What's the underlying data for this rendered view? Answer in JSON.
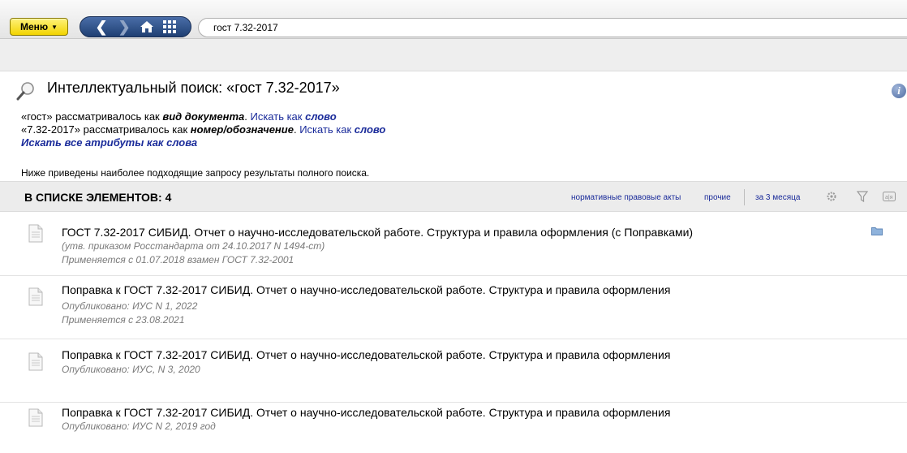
{
  "toolbar": {
    "menu_label": "Меню",
    "search_value": "гост 7.32-2017",
    "icons": [
      "back-icon",
      "forward-icon",
      "home-icon",
      "grid-icon"
    ]
  },
  "header": {
    "title": "Интеллектуальный поиск: «гост 7.32-2017»",
    "interpretations": [
      {
        "term": "«гост»",
        "text": " рассматривалось как ",
        "as": "вид документа",
        "link_prefix": "Искать как ",
        "link_word": "слово"
      },
      {
        "term": "«7.32-2017»",
        "text": " рассматривалось как ",
        "as": "номер/обозначение",
        "link_prefix": "Искать как ",
        "link_word": "слово"
      }
    ],
    "all_as_words": "Искать все атрибуты как слова",
    "note": "Ниже приведены наиболее подходящие запросу результаты полного поиска."
  },
  "list": {
    "title": "В СПИСКЕ ЭЛЕМЕНТОВ: 4",
    "filters": [
      "нормативные правовые акты",
      "прочие",
      "за 3 месяца"
    ],
    "items": [
      {
        "title": "ГОСТ 7.32-2017 СИБИД. Отчет о научно-исследовательской работе. Структура и правила оформления (с Поправками)",
        "meta": [
          "(утв. приказом Росстандарта от 24.10.2017 N 1494-ст)",
          "Применяется с 01.07.2018 взамен ГОСТ 7.32-2001"
        ]
      },
      {
        "title": "Поправка к ГОСТ 7.32-2017 СИБИД. Отчет о научно-исследовательской работе. Структура и правила оформления",
        "meta": [
          "Опубликовано: ИУС N 1, 2022",
          "Применяется с 23.08.2021"
        ]
      },
      {
        "title": "Поправка к ГОСТ 7.32-2017 СИБИД. Отчет о научно-исследовательской работе. Структура и правила оформления",
        "meta": [
          "Опубликовано: ИУС, N 3, 2020"
        ]
      },
      {
        "title": "Поправка к ГОСТ 7.32-2017 СИБИД. Отчет о научно-исследовательской работе. Структура и правила оформления",
        "meta": [
          "Опубликовано: ИУС N 2, 2019 год"
        ]
      }
    ]
  },
  "colors": {
    "menu_yellow": "#f2d400",
    "nav_blue": "#2b4b82",
    "link_blue": "#1a2b9a",
    "meta_grey": "#7a7a7a",
    "list_header_bg": "#ececec"
  }
}
